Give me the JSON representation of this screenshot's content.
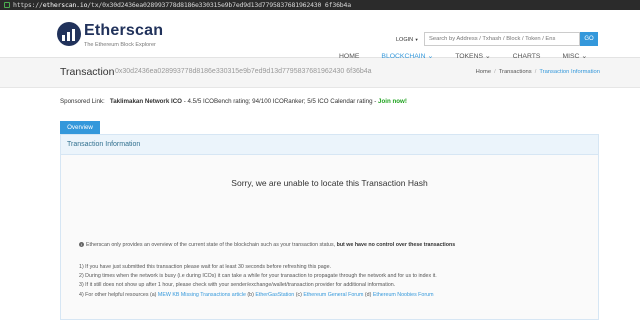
{
  "browser": {
    "scheme": "https://",
    "host": "etherscan.io",
    "path": "/tx/0x30d2436ea028993778d8186e330315e9b7ed9d13d7795837681962430 6f36b4a"
  },
  "header": {
    "brand_name": "Etherscan",
    "brand_sub": "The Ethereum Block Explorer",
    "login": "LOGIN",
    "search_placeholder": "Search by Address / Txhash / Block / Token / Ens",
    "go_label": "GO"
  },
  "nav": {
    "items": [
      {
        "label": "HOME"
      },
      {
        "label": "BLOCKCHAIN ⌄"
      },
      {
        "label": "TOKENS ⌄"
      },
      {
        "label": "CHARTS"
      },
      {
        "label": "MISC ⌄"
      }
    ],
    "active_index": 1
  },
  "title_band": {
    "title": "Transaction",
    "hash": "0x30d2436ea028993778d8186e330315e9b7ed9d13d7795837681962430 6f36b4a",
    "breadcrumb": [
      "Home",
      "Transactions",
      "Transaction Information"
    ]
  },
  "sponsored": {
    "label": "Sponsored Link:",
    "name": "Taklimakan Network ICO",
    "ratings": " - 4.5/5 ICOBench rating; 94/100 ICORanker; 5/5 ICO Calendar rating - ",
    "cta": "Join now!"
  },
  "panel": {
    "tab_label": "Overview",
    "heading": "Transaction Information",
    "sorry": "Sorry, we are unable to locate this Transaction Hash",
    "info_plain": "Etherscan only provides an overview of the current state of the blockchain such as your transaction status,",
    "info_bold": "but we have no control over these transactions",
    "step1": "1) If you have just submitted this transaction please wait for at least 30 seconds before refreshing this page.",
    "step2": "2) During times when the network is busy (i.e during ICOs) it can take a while for your transaction to propagate through the network and for us to index it.",
    "step3": "3) If it still does not show up after 1 hour, please check with your sender/exchange/wallet/transaction provider for additional information.",
    "step4_prefix": "4) For other helpful resources (a)",
    "link_a": "MEW KB Missing Transactions article",
    "sep_b": " (b) ",
    "link_b": "EtherGasStation",
    "sep_c": " (c) ",
    "link_c": "Ethereum General Forum",
    "sep_d": " (d) ",
    "link_d": "Ethereum Noobies Forum"
  },
  "colors": {
    "accent": "#3498db",
    "brand": "#21325b",
    "sponsor_cta": "#1ea21e"
  }
}
